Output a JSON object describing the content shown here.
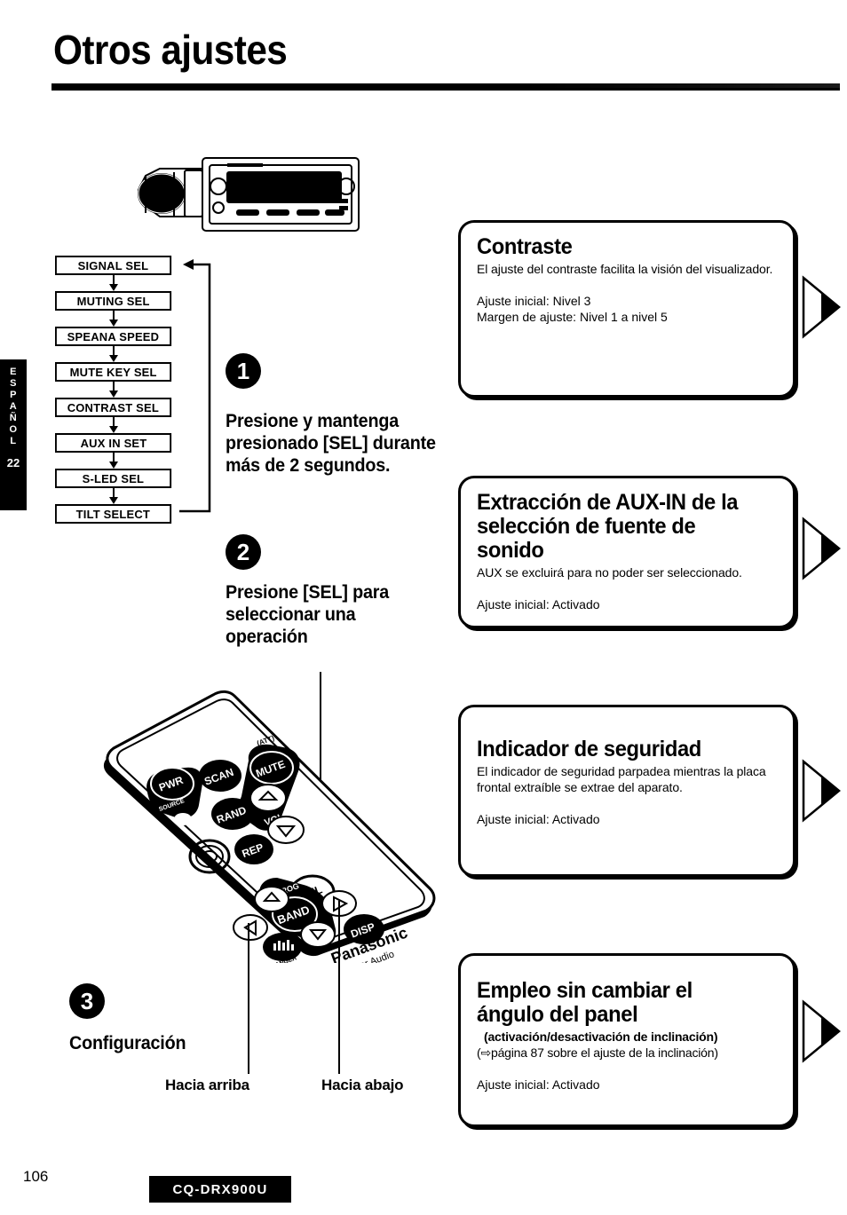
{
  "page": {
    "title": "Otros ajustes",
    "page_number": "106",
    "model": "CQ-DRX900U"
  },
  "language_tab": {
    "letters": [
      "E",
      "S",
      "P",
      "A",
      "Ñ",
      "O",
      "L"
    ],
    "number": "22"
  },
  "flow_chart": {
    "steps": [
      "SIGNAL SEL",
      "MUTING SEL",
      "SPEANA SPEED",
      "MUTE KEY SEL",
      "CONTRAST SEL",
      "AUX IN SET",
      "S-LED SEL",
      "TILT SELECT"
    ]
  },
  "steps": [
    {
      "number": "1",
      "text": "Presione y mantenga presionado [SEL] durante más de 2 segundos."
    },
    {
      "number": "2",
      "text": "Presione [SEL] para seleccionar una operación"
    },
    {
      "number": "3",
      "text": "Configuración"
    }
  ],
  "remote_labels": {
    "up": "Hacia arriba",
    "down": "Hacia abajo"
  },
  "remote_buttons": {
    "pwr": "PWR",
    "source": "SOURCE",
    "scan": "SCAN",
    "mute": "MUTE",
    "att": "(ATT)",
    "rand": "RAND",
    "vol": "VOL",
    "rep": "REP",
    "sel": "SEL",
    "band": "BAND",
    "prog": "PROG",
    "disp": "DISP",
    "changer": "CHANGER",
    "brand": "Panasonic",
    "brand_sub": "Car Audio"
  },
  "cards": [
    {
      "title": "Contraste",
      "desc": "El ajuste del contraste facilita la visión del visualizador.",
      "setting_lines": [
        "Ajuste inicial: Nivel 3",
        "Margen de ajuste: Nivel 1 a nivel 5"
      ]
    },
    {
      "title": "Extracción de AUX-IN de la selección de fuente de sonido",
      "desc": "AUX se excluirá para no poder ser seleccionado.",
      "setting_lines": [
        "Ajuste inicial: Activado"
      ]
    },
    {
      "title": "Indicador de seguridad",
      "desc": "El indicador de seguridad parpadea mientras la placa frontal extraíble se extrae del aparato.",
      "setting_lines": [
        "Ajuste inicial: Activado"
      ]
    },
    {
      "title": "Empleo sin cambiar el ángulo del panel",
      "subnote": "(activación/desactivación de inclinación)",
      "subnote2": "(⇨página 87 sobre el ajuste de la inclinación)",
      "setting_lines": [
        "Ajuste inicial: Activado"
      ]
    }
  ]
}
